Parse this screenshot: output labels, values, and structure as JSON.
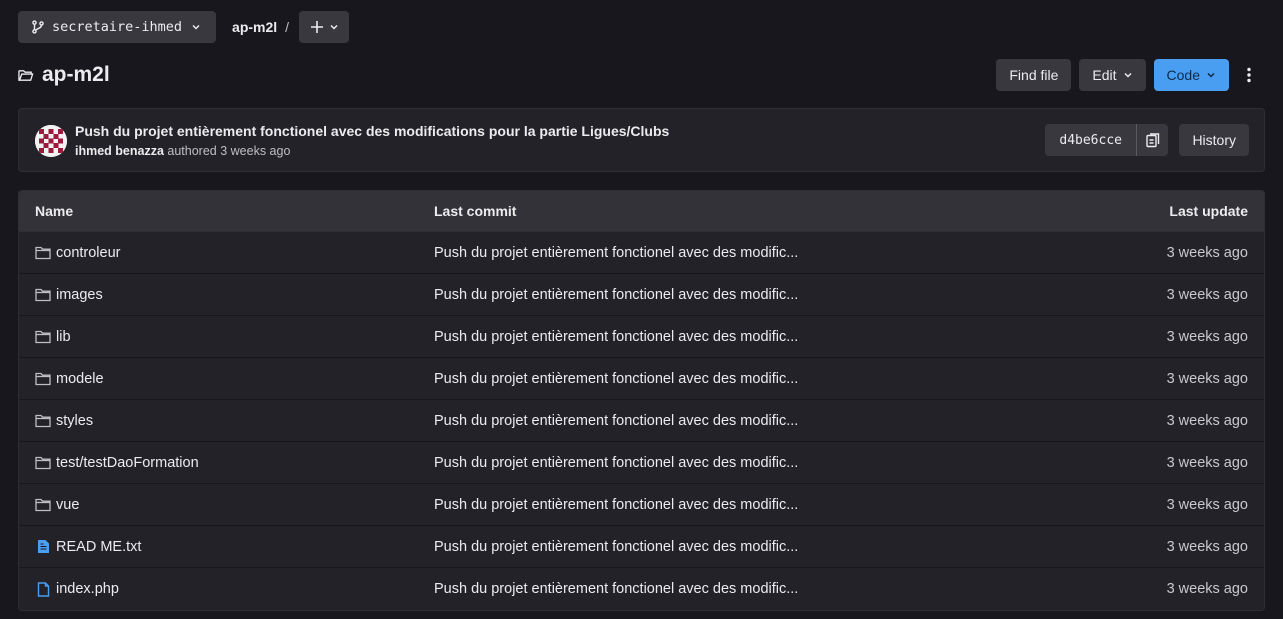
{
  "topbar": {
    "branch": "secretaire-ihmed",
    "breadcrumb_project": "ap-m2l",
    "breadcrumb_sep": "/"
  },
  "header": {
    "title": "ap-m2l",
    "find_file": "Find file",
    "edit": "Edit",
    "code": "Code"
  },
  "commit": {
    "message": "Push du projet entièrement fonctionel avec des modifications pour la partie Ligues/Clubs",
    "author": "ihmed benazza",
    "authored_text": "authored 3 weeks ago",
    "sha": "d4be6cce",
    "history": "History"
  },
  "table": {
    "headers": {
      "name": "Name",
      "last_commit": "Last commit",
      "last_update": "Last update"
    },
    "rows": [
      {
        "name": "controleur",
        "icon": "folder-icon",
        "commit": "Push du projet entièrement fonctionel avec des modific...",
        "updated": "3 weeks ago"
      },
      {
        "name": "images",
        "icon": "folder-icon",
        "commit": "Push du projet entièrement fonctionel avec des modific...",
        "updated": "3 weeks ago"
      },
      {
        "name": "lib",
        "icon": "folder-icon",
        "commit": "Push du projet entièrement fonctionel avec des modific...",
        "updated": "3 weeks ago"
      },
      {
        "name": "modele",
        "icon": "folder-icon",
        "commit": "Push du projet entièrement fonctionel avec des modific...",
        "updated": "3 weeks ago"
      },
      {
        "name": "styles",
        "icon": "folder-icon",
        "commit": "Push du projet entièrement fonctionel avec des modific...",
        "updated": "3 weeks ago"
      },
      {
        "name": "test/testDaoFormation",
        "icon": "folder-icon",
        "commit": "Push du projet entièrement fonctionel avec des modific...",
        "updated": "3 weeks ago"
      },
      {
        "name": "vue",
        "icon": "folder-icon",
        "commit": "Push du projet entièrement fonctionel avec des modific...",
        "updated": "3 weeks ago"
      },
      {
        "name": "READ ME.txt",
        "icon": "text-file-icon",
        "commit": "Push du projet entièrement fonctionel avec des modific...",
        "updated": "3 weeks ago"
      },
      {
        "name": "index.php",
        "icon": "file-icon",
        "commit": "Push du projet entièrement fonctionel avec des modific...",
        "updated": "3 weeks ago"
      }
    ]
  },
  "colors": {
    "background": "#18171d",
    "panel": "#232228",
    "button": "#3a383f",
    "primary": "#4a9ef1",
    "file_icon": "#4a9ef1"
  }
}
